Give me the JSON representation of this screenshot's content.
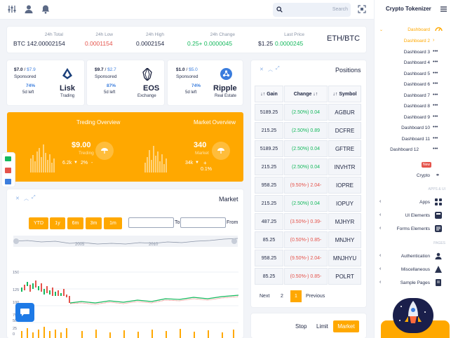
{
  "topbar": {
    "search_placeholder": "Search"
  },
  "stats": [
    {
      "label": "24h Total",
      "value": "BTC 142.00002154"
    },
    {
      "label": "24h Low",
      "value": "0.0001154"
    },
    {
      "label": "24h High",
      "value": "0.0002154"
    },
    {
      "label": "24h Change",
      "value": "0.25+ 0.0000045"
    },
    {
      "label": "Last Price",
      "value_prefix": "$1.25",
      "value": "0.0000245"
    }
  ],
  "pair": "ETH/BTC",
  "coins": [
    {
      "price": "$7.0",
      "price2": "$7.9",
      "sponsored": "Sponsored",
      "pct": "74%",
      "days": "5d left",
      "name": "Lisk",
      "sub": "Trading"
    },
    {
      "price": "$9.7",
      "price2": "$2.7",
      "sponsored": "Sponsored",
      "pct": "87%",
      "days": "5d left",
      "name": "EOS",
      "sub": "Exchange"
    },
    {
      "price": "$1.0",
      "price2": "$5.0",
      "sponsored": "Sponsored",
      "pct": "74%",
      "days": "5d left",
      "name": "Ripple",
      "sub": "Real Estate"
    }
  ],
  "overview": {
    "trading_title": "Treding Overview",
    "market_title": "Market Overview",
    "trading_value": "$9.00",
    "trading_label": "Treding",
    "trading_k": "6.2k",
    "trading_pct": "2%",
    "market_value": "340",
    "market_label": "Market",
    "market_k": "34k",
    "market_pct": "0.1%"
  },
  "market": {
    "title": "Market",
    "ranges": [
      "YTD",
      "1y",
      "6m",
      "3m",
      "1m"
    ],
    "to": "To",
    "from": "From",
    "years": [
      "2005",
      "2010"
    ],
    "yticks": [
      "150",
      "125",
      "100",
      "75",
      "50",
      "25",
      "0"
    ]
  },
  "positions": {
    "title": "Positions",
    "headers": [
      "Gain",
      "Change",
      "Symbol"
    ],
    "rows": [
      {
        "gain": "5189.25",
        "change": "(2.50%) 0.04",
        "symbol": "AGBUR",
        "dir": "pos"
      },
      {
        "gain": "215.25",
        "change": "(2.50%) 0.89",
        "symbol": "DCFRE",
        "dir": "pos"
      },
      {
        "gain": "5189.25",
        "change": "(2.50%) 0.04",
        "symbol": "GFTRE",
        "dir": "pos"
      },
      {
        "gain": "215.25",
        "change": "(2.50%) 0.04",
        "symbol": "INVHTR",
        "dir": "pos"
      },
      {
        "gain": "958.25",
        "change": "(9.50%-) 2.04-",
        "symbol": "IOPRE",
        "dir": "neg"
      },
      {
        "gain": "215.25",
        "change": "(2.50%) 0.04",
        "symbol": "IOPUY",
        "dir": "pos"
      },
      {
        "gain": "487.25",
        "change": "(3.50%-) 0.39-",
        "symbol": "MJHYR",
        "dir": "neg"
      },
      {
        "gain": "85.25",
        "change": "(0.50%-) 0.85-",
        "symbol": "MNJHY",
        "dir": "neg"
      },
      {
        "gain": "958.25",
        "change": "(9.50%-) 2.04-",
        "symbol": "MNJHYU",
        "dir": "neg"
      },
      {
        "gain": "85.25",
        "change": "(0.50%-) 0.85-",
        "symbol": "POLRT",
        "dir": "neg"
      }
    ],
    "pager": {
      "next": "Next",
      "p2": "2",
      "p1": "1",
      "prev": "Previous"
    }
  },
  "order": {
    "stop": "Stop",
    "limit": "Limit",
    "market": "Market"
  },
  "sidebar": {
    "title": "Crypto Tokenizer",
    "dashboard": "Dashboard",
    "items": [
      "Dashboard 2",
      "Dashboard 3",
      "Dashboard 4",
      "Dashboard 5",
      "Dashboard 6",
      "Dashboard 7",
      "Dashboard 8",
      "Dashboard 9",
      "Dashboard 10",
      "Dashboard 11",
      "Dashboard 12"
    ],
    "new_badge": "New",
    "crypto": "Crypto",
    "apps_section": "APPS & UI",
    "apps": "Apps",
    "ui": "UI Elements",
    "forms": "Forms Elements",
    "pages_section": "PAGES",
    "auth": "Authentication",
    "misc": "Miscellaneous",
    "sample": "Sample Pages"
  },
  "colors": {
    "accent": "#ffa800",
    "blue": "#3b7ddd",
    "green": "#14b85c",
    "red": "#e5534b"
  }
}
